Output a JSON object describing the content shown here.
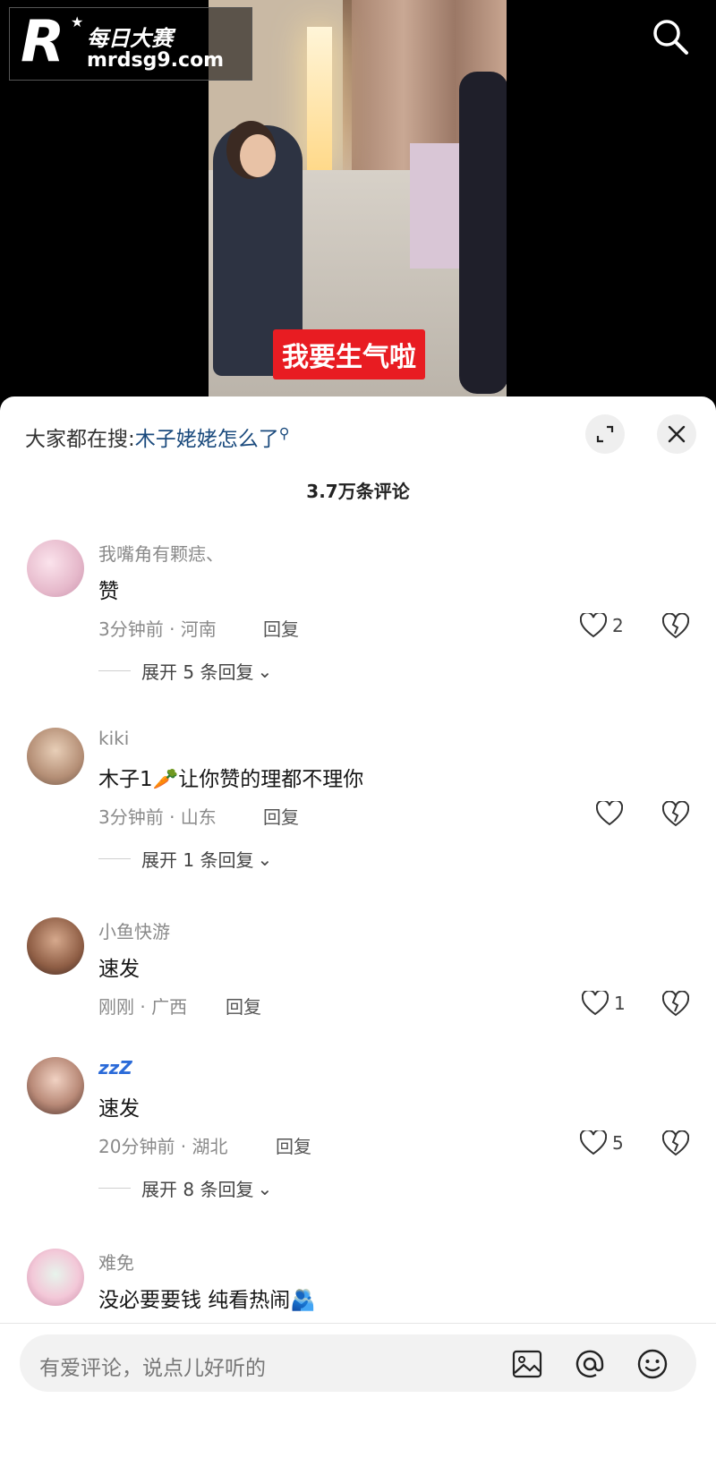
{
  "watermark": {
    "brand": "每日大赛",
    "url": "mrdsg9.com",
    "letter": "R"
  },
  "video": {
    "subtitle": "我要生气啦"
  },
  "panel": {
    "hot_prefix": "大家都在搜:",
    "hot_keyword": "木子姥姥怎么了",
    "comment_count": "3.7万条评论"
  },
  "comments": [
    {
      "user": "我嘴角有颗痣、",
      "text": "赞",
      "meta": "3分钟前 · 河南",
      "reply": "回复",
      "likes": "2",
      "expand": "展开 5 条回复"
    },
    {
      "user": "kiki",
      "text": "木子1🥕让你赞的理都不理你",
      "meta": "3分钟前 · 山东",
      "reply": "回复",
      "likes": "",
      "expand": "展开 1 条回复"
    },
    {
      "user": "小鱼快游",
      "text": "速发",
      "meta": "刚刚 · 广西",
      "reply": "回复",
      "likes": "1",
      "expand": ""
    },
    {
      "user": "zzZ",
      "text": "速发",
      "meta": "20分钟前 · 湖北",
      "reply": "回复",
      "likes": "5",
      "expand": "展开 8 条回复"
    },
    {
      "user": "难免",
      "text": "没必要要钱  纯看热闹🫂",
      "meta": "",
      "reply": "",
      "likes": "",
      "expand": ""
    }
  ],
  "input": {
    "placeholder": "有爱评论，说点儿好听的"
  },
  "icons": {
    "search": "search-icon",
    "expand": "expand-icon",
    "close": "close-icon",
    "like": "heart-icon",
    "dislike": "broken-heart-icon",
    "image": "image-icon",
    "mention": "at-icon",
    "emoji": "emoji-icon"
  }
}
